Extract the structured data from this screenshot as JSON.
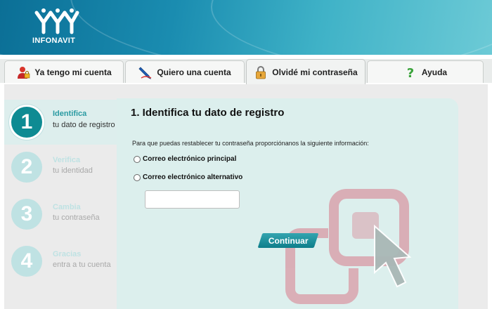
{
  "brand": {
    "name": "INFONAVIT"
  },
  "tabs": [
    {
      "label": "Ya tengo mi cuenta",
      "icon": "user-lock-icon"
    },
    {
      "label": "Quiero una cuenta",
      "icon": "pen-icon"
    },
    {
      "label": "Olvidé mi contraseña",
      "icon": "padlock-icon",
      "active": true
    },
    {
      "label": "Ayuda",
      "icon": "question-icon"
    }
  ],
  "steps": [
    {
      "number": "1",
      "title": "Identifica",
      "subtitle": "tu dato de registro",
      "active": true
    },
    {
      "number": "2",
      "title": "Verifica",
      "subtitle": "tu identidad",
      "active": false
    },
    {
      "number": "3",
      "title": "Cambia",
      "subtitle": "tu contraseña",
      "active": false
    },
    {
      "number": "4",
      "title": "Gracias",
      "subtitle": "entra a tu cuenta",
      "active": false
    }
  ],
  "form": {
    "title": "1. Identifica tu dato de registro",
    "intro": "Para que puedas restablecer tu contraseña proporciónanos la siguiente información:",
    "options": [
      "Correo electrónico principal",
      "Correo electrónico alternativo"
    ],
    "input_value": "",
    "continue_label": "Continuar"
  },
  "colors": {
    "accent": "#0e8b93",
    "step_inactive": "#bfe2e3",
    "deco": "#d9a3ad"
  }
}
